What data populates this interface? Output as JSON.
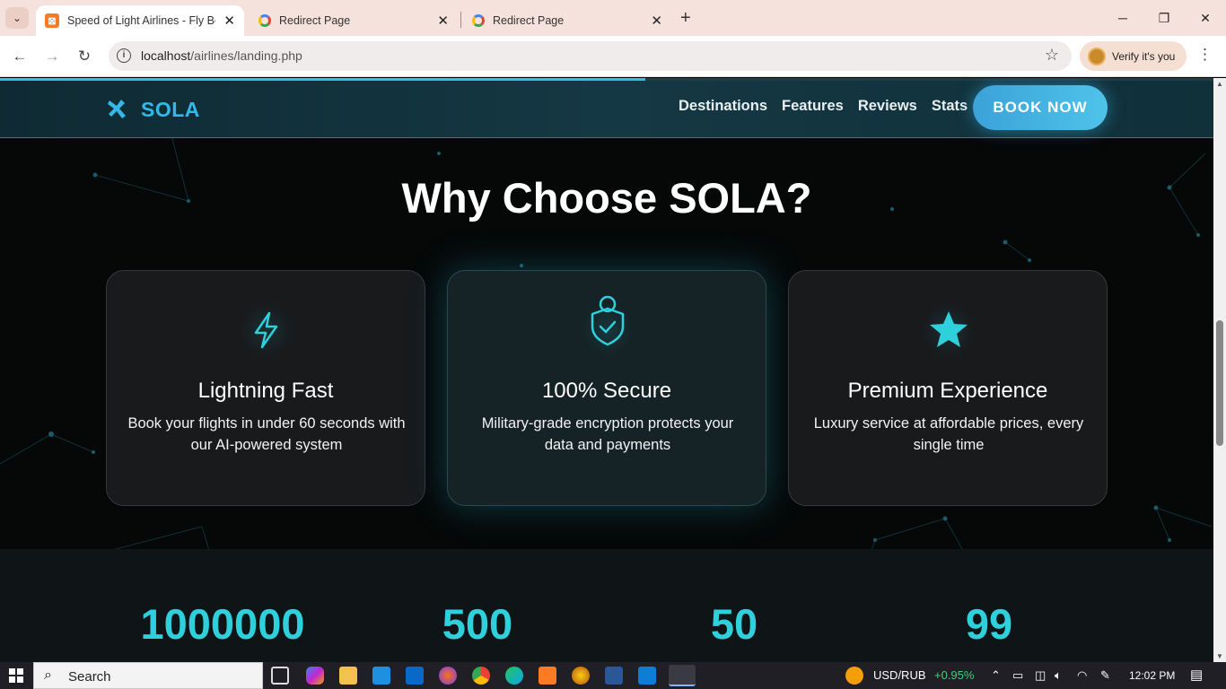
{
  "browser": {
    "tabs": [
      {
        "title": "Speed of Light Airlines - Fly Bey",
        "favicon": "xampp-icon",
        "active": true
      },
      {
        "title": "Redirect Page",
        "favicon": "google-icon",
        "active": false
      },
      {
        "title": "Redirect Page",
        "favicon": "google-icon",
        "active": false
      }
    ],
    "url_host": "localhost",
    "url_path": "/airlines/landing.php",
    "profile_label": "Verify it's you"
  },
  "page": {
    "scroll_progress": 0.532,
    "nav": {
      "logo_text": "SOLA",
      "links": [
        "Destinations",
        "Features",
        "Reviews",
        "Stats"
      ],
      "cta": "BOOK NOW"
    },
    "section_title": "Why Choose SOLA?",
    "features": [
      {
        "icon": "lightning-icon",
        "title": "Lightning Fast",
        "description": "Book your flights in under 60 seconds with our AI-powered system"
      },
      {
        "icon": "shield-check-icon",
        "title": "100% Secure",
        "description": "Military-grade encryption protects your data and payments"
      },
      {
        "icon": "star-icon",
        "title": "Premium Experience",
        "description": "Luxury service at affordable prices, every single time"
      }
    ],
    "stats": [
      "1000000",
      "500",
      "50",
      "99"
    ],
    "colors": {
      "accent": "#2ed0dc",
      "logo": "#34b7ea",
      "background": "#060808"
    }
  },
  "taskbar": {
    "search_label": "Search",
    "ticker_symbol": "USD/RUB",
    "ticker_change": "+0.95%",
    "time": "12:02 PM"
  }
}
